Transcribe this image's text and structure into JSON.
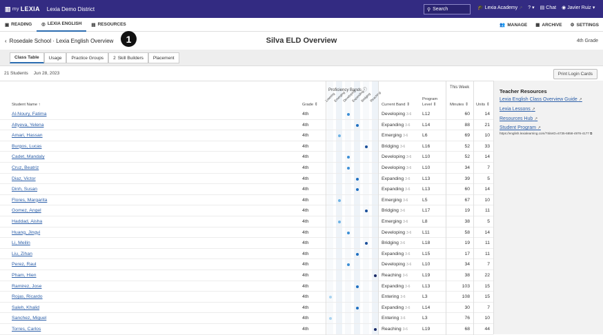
{
  "topbar": {
    "brand_small": "my",
    "brand": "LEXIA",
    "district": "Lexia Demo District",
    "search_placeholder": "Search",
    "links": [
      "Lexia Academy",
      "?",
      "Chat",
      "Javier Ruiz"
    ]
  },
  "nav": {
    "tabs": [
      "READING",
      "LEXIA ENGLISH",
      "RESOURCES"
    ],
    "right": [
      "MANAGE",
      "ARCHIVE",
      "SETTINGS"
    ]
  },
  "header": {
    "breadcrumb": "Rosedale School · Lexia English Overview",
    "title": "Silva ELD Overview",
    "grade": "4th Grade",
    "callout": "1"
  },
  "subtabs": [
    "Class Table",
    "Usage",
    "Practice Groups",
    "Skill Builders",
    "Placement"
  ],
  "skill_builders_count": "2",
  "status": {
    "students": "21 Students",
    "date": "Jun 28, 2023",
    "print": "Print Login Cards"
  },
  "table": {
    "headers": {
      "name": "Student Name",
      "grade": "Grade",
      "bands": "Proficiency Bands",
      "band_labels": [
        "Entering",
        "Emerging",
        "Developing",
        "Expanding",
        "Bridging",
        "Reaching"
      ],
      "current": "Current Band",
      "program": "Program",
      "level": "Level",
      "this_week": "This Week",
      "minutes": "Minutes",
      "units": "Units"
    },
    "rows": [
      {
        "name": "Al-Noury, Fatima",
        "grade": "4th",
        "band": "Developing",
        "sub": "3-6",
        "level": "L12",
        "minutes": "60",
        "units": "14",
        "idx": 2
      },
      {
        "name": "Altyeva, Yelena",
        "grade": "4th",
        "band": "Expanding",
        "sub": "3-6",
        "level": "L14",
        "minutes": "88",
        "units": "21",
        "idx": 3
      },
      {
        "name": "Amari, Hassan",
        "grade": "4th",
        "band": "Emerging",
        "sub": "3-6",
        "level": "L6",
        "minutes": "69",
        "units": "10",
        "idx": 1
      },
      {
        "name": "Burgos, Lucas",
        "grade": "4th",
        "band": "Bridging",
        "sub": "3-6",
        "level": "L16",
        "minutes": "52",
        "units": "33",
        "idx": 4
      },
      {
        "name": "Cadet, Mandaly",
        "grade": "4th",
        "band": "Developing",
        "sub": "3-6",
        "level": "L10",
        "minutes": "52",
        "units": "14",
        "idx": 2
      },
      {
        "name": "Cruz, Beatriz",
        "grade": "4th",
        "band": "Developing",
        "sub": "3-6",
        "level": "L10",
        "minutes": "34",
        "units": "7",
        "idx": 2
      },
      {
        "name": "Diaz, Victor",
        "grade": "4th",
        "band": "Expanding",
        "sub": "3-6",
        "level": "L13",
        "minutes": "39",
        "units": "5",
        "idx": 3
      },
      {
        "name": "Dinh, Susan",
        "grade": "4th",
        "band": "Expanding",
        "sub": "3-6",
        "level": "L13",
        "minutes": "60",
        "units": "14",
        "idx": 3
      },
      {
        "name": "Flores, Margarita",
        "grade": "4th",
        "band": "Emerging",
        "sub": "3-6",
        "level": "L5",
        "minutes": "67",
        "units": "10",
        "idx": 1
      },
      {
        "name": "Gomez, Angel",
        "grade": "4th",
        "band": "Bridging",
        "sub": "3-6",
        "level": "L17",
        "minutes": "19",
        "units": "11",
        "idx": 4
      },
      {
        "name": "Haddad, Aisha",
        "grade": "4th",
        "band": "Emerging",
        "sub": "3-6",
        "level": "L8",
        "minutes": "38",
        "units": "5",
        "idx": 1
      },
      {
        "name": "Huang, Jingyi",
        "grade": "4th",
        "band": "Developing",
        "sub": "3-6",
        "level": "L11",
        "minutes": "58",
        "units": "14",
        "idx": 2
      },
      {
        "name": "Li, Meilin",
        "grade": "4th",
        "band": "Bridging",
        "sub": "3-6",
        "level": "L18",
        "minutes": "19",
        "units": "11",
        "idx": 4
      },
      {
        "name": "Liu, Zihan",
        "grade": "4th",
        "band": "Expanding",
        "sub": "3-6",
        "level": "L15",
        "minutes": "17",
        "units": "11",
        "idx": 3
      },
      {
        "name": "Perez, Raul",
        "grade": "4th",
        "band": "Developing",
        "sub": "3-6",
        "level": "L10",
        "minutes": "34",
        "units": "7",
        "idx": 2
      },
      {
        "name": "Pham, Hien",
        "grade": "4th",
        "band": "Reaching",
        "sub": "3-6",
        "level": "L19",
        "minutes": "38",
        "units": "22",
        "idx": 5
      },
      {
        "name": "Ramirez, Jose",
        "grade": "4th",
        "band": "Expanding",
        "sub": "3-6",
        "level": "L13",
        "minutes": "103",
        "units": "15",
        "idx": 3
      },
      {
        "name": "Rojas, Ricardo",
        "grade": "4th",
        "band": "Entering",
        "sub": "3-6",
        "level": "L3",
        "minutes": "108",
        "units": "15",
        "idx": 0
      },
      {
        "name": "Saleh, Khalid",
        "grade": "4th",
        "band": "Expanding",
        "sub": "3-6",
        "level": "L14",
        "minutes": "30",
        "units": "7",
        "idx": 3
      },
      {
        "name": "Sanchez, Miguel",
        "grade": "4th",
        "band": "Entering",
        "sub": "3-6",
        "level": "L3",
        "minutes": "76",
        "units": "10",
        "idx": 0
      },
      {
        "name": "Torres, Carlos",
        "grade": "4th",
        "band": "Reaching",
        "sub": "3-6",
        "level": "L19",
        "minutes": "68",
        "units": "44",
        "idx": 5
      }
    ]
  },
  "resources": {
    "title": "Teacher Resources",
    "links": [
      "Lexia English Class Overview Guide",
      "Lexia Lessons",
      "Resources Hub",
      "Student Program"
    ],
    "url": "https://english.lexialearning.com/?SiteID=6735-6858-4976-4177"
  },
  "colors": {
    "brand": "#332b82",
    "link": "#2b5ea8",
    "band_colors": [
      "#a9d3f0",
      "#6fb4e6",
      "#3d8fd6",
      "#1f6fc1",
      "#1b4f9a",
      "#1a2a66"
    ]
  }
}
